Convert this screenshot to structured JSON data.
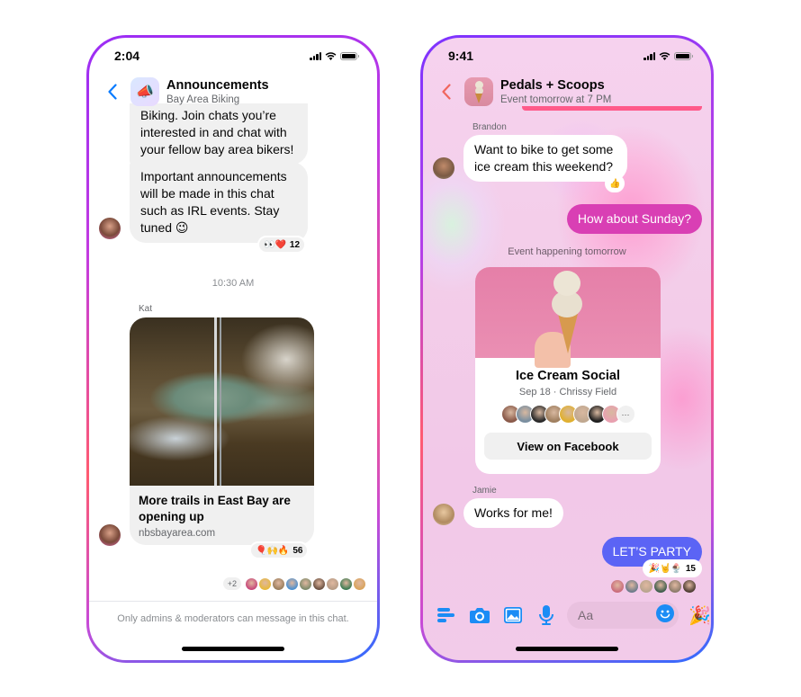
{
  "left_phone": {
    "status": {
      "time": "2:04"
    },
    "header": {
      "title": "Announcements",
      "subtitle": "Bay Area Biking",
      "avatar_icon": "megaphone-icon",
      "avatar_glyph": "📣"
    },
    "messages": [
      {
        "text": "Biking. Join chats you’re interested in and chat with your fellow bay area bikers!"
      },
      {
        "text": "Important announcements will be made in this chat such as IRL events. Stay tuned 😉",
        "reactions": "👀❤️",
        "reaction_count": "12"
      }
    ],
    "timestamp": "10:30 AM",
    "link_message": {
      "sender": "Kat",
      "title": "More trails in East Bay are opening up",
      "domain": "nbsbayarea.com",
      "reactions": "🎈🙌🔥",
      "reaction_count": "56"
    },
    "seen_extra": "+2",
    "seen_avatar_colors": [
      "#c7467a",
      "#e6b83a",
      "#9a7d5b",
      "#4a8fd0",
      "#7c8a6a",
      "#6a5040",
      "#b69b85",
      "#3a7a50",
      "#d9a35a"
    ],
    "admin_notice": "Only admins & moderators can message in this chat.",
    "colors": {
      "back_arrow": "#0a7cff",
      "incoming_bubble": "#f0f0f0"
    }
  },
  "right_phone": {
    "status": {
      "time": "9:41"
    },
    "header": {
      "title": "Pedals + Scoops",
      "subtitle": "Event tomorrow at 7 PM"
    },
    "messages": [
      {
        "sender": "Brandon",
        "text": "Want to bike to get some ice cream this weekend?",
        "reaction": "👍"
      },
      {
        "text": "How about Sunday?",
        "outgoing": true
      }
    ],
    "event_label": "Event happening tomorrow",
    "event_card": {
      "title": "Ice Cream Social",
      "subtitle": "Sep 18 · Chrissy Field",
      "attendee_colors": [
        "#8a5a4a",
        "#7a8fa0",
        "#2a2a2a",
        "#a08060",
        "#e0b030",
        "#c0a890",
        "#1e1e1e",
        "#e8a0b0"
      ],
      "more_label": "···",
      "button_label": "View on Facebook"
    },
    "jamie_message": {
      "sender": "Jamie",
      "text": "Works for me!"
    },
    "party_message": {
      "text": "LET’S PARTY",
      "reactions": "🎉🤘🍨",
      "reaction_count": "15"
    },
    "seen_avatar_colors": [
      "#c96a7a",
      "#6a7a8a",
      "#b8a48e",
      "#3a5a4a",
      "#8a7a6a",
      "#4a3a30"
    ],
    "composer": {
      "placeholder": "Aa",
      "icons": [
        "menu-icon",
        "camera-icon",
        "gallery-icon",
        "microphone-icon"
      ],
      "emoji_icon": "emoji-icon",
      "party_glyph": "🎉"
    },
    "colors": {
      "back_arrow": "#f0665e",
      "outgoing_pink": "#d93fb4",
      "outgoing_blue": "#5b64f5",
      "accent_icon": "#1b8cf5",
      "pinned_bar": "#ff5a8a"
    }
  }
}
